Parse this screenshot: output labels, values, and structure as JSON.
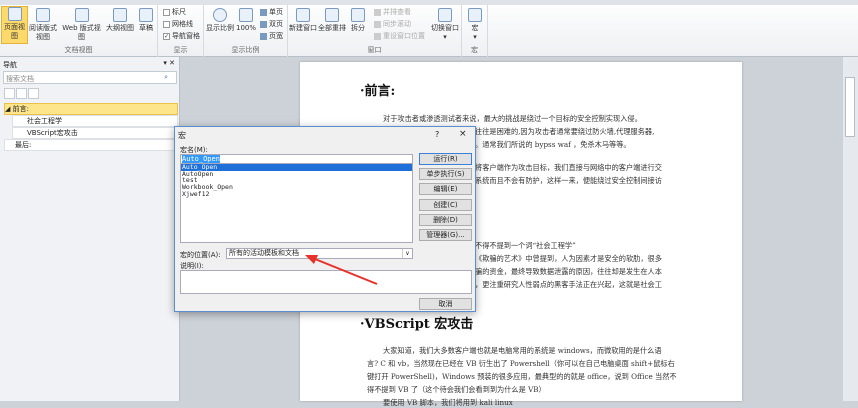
{
  "ribbon": {
    "groups": [
      {
        "label": "文档视图"
      },
      {
        "label": "显示"
      },
      {
        "label": "显示比例"
      },
      {
        "label": "窗口"
      },
      {
        "label": "宏"
      }
    ],
    "views": [
      "页面视图",
      "阅读版式视图",
      "Web 版式视图",
      "大纲视图",
      "草稿"
    ],
    "show": [
      {
        "label": "标尺",
        "checked": false
      },
      {
        "label": "网格线",
        "checked": false
      },
      {
        "label": "导航窗格",
        "checked": true
      }
    ],
    "zoom": {
      "zoom_label": "显示比例",
      "percent": "100%",
      "one_page": "单页",
      "two_pages": "双页",
      "page_width": "页宽"
    },
    "window": {
      "new_window": "新建窗口",
      "arrange_all": "全部重排",
      "split": "拆分",
      "side_by_side": "并排查看",
      "sync_scroll": "同步滚动",
      "reset_pos": "重设窗口位置",
      "switch": "切换窗口"
    },
    "macros": "宏"
  },
  "nav": {
    "title": "导航",
    "search_placeholder": "搜索文档",
    "items": [
      {
        "label": "前言:",
        "level": 1,
        "selected": true
      },
      {
        "label": "社会工程学",
        "level": 2
      },
      {
        "label": "VBScript宏攻击",
        "level": 2
      },
      {
        "label": "最后:",
        "level": 1
      }
    ]
  },
  "document": {
    "heading1": "·前言:",
    "p1": [
      "对于攻击者或渗透测试者来说，最大的挑战是绕过一个目标的安全控制实现入侵。",
      "往往是困难的,因为攻击者通常要绕过防火墙,代理服务器,",
      "。通常我们所说的 bypss waf ，免杀木马等等。"
    ],
    "p2": [
      "将客户端作为攻击目标，我们直接与网络中的客户端进行交",
      "系统而且不会有防护，这样一来，便能绕过安全控制间接访"
    ],
    "p3": [
      "不得不提到一个词“社会工程学”",
      "《欺骗的艺术》中曾提到，人为因素才是安全的软肋，很多",
      "骗的资金，最终导致数据泄露的原因，往往却是发生在人本",
      "，更注重研究人性弱点的黑客手法正在兴起，这就是社会工"
    ],
    "heading2": "·VBScript 宏攻击",
    "p4": [
      "大家知道，我们大多数客户端也就是电脑常用的系统是 windows，而微软用的是什么语",
      "言? C 和 vb，当然现在已经在 VB 衍生出了 Powershell（你可以在自己电脑桌面 shift+鼠标右",
      "键打开 PowerShell)，Windows 预装的很多应用，最典型的的就是 office，说到 Office 当然不",
      "得不提到 VB 了（这个待会我们会看到到为什么是 VB）"
    ],
    "p5": "要使用 VB 脚本，我们将用到 kali linux"
  },
  "dialog": {
    "title": "宏",
    "help": "?",
    "close": "×",
    "name_label": "宏名(M):",
    "name_value": "Auto_Open",
    "macros": [
      "Auto_Open",
      "AutoOpen",
      "test",
      "Workbook_Open",
      "Xjwef12"
    ],
    "buttons": [
      "运行(R)",
      "单步执行(S)",
      "编辑(E)",
      "创建(C)",
      "删除(D)",
      "管理器(G)..."
    ],
    "location_label": "宏的位置(A):",
    "location_value": "所有的活动模板和文档",
    "desc_label": "说明(I):",
    "cancel": "取消"
  },
  "colors": {
    "selected": "#fde58c",
    "accent": "#1e70d8",
    "arrow": "#e8302a"
  }
}
